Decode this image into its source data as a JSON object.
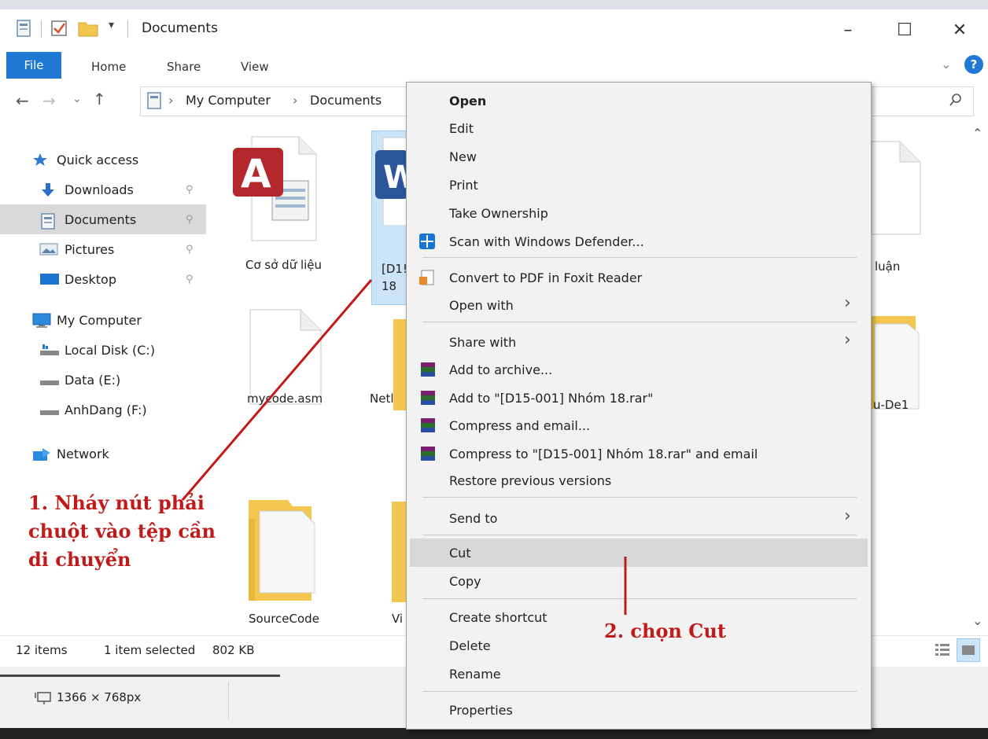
{
  "window": {
    "title": "Documents",
    "controls": {
      "minimize": "–",
      "maximize": "☐",
      "close": "✕"
    }
  },
  "ribbon": {
    "tabs": [
      "File",
      "Home",
      "Share",
      "View"
    ],
    "help": "?",
    "collapse": "⌄"
  },
  "address": {
    "back": "←",
    "forward": "→",
    "recent": "⌄",
    "up": "↑",
    "crumbs": [
      "My Computer",
      "Documents"
    ],
    "separator": "›",
    "search_icon": "search-icon"
  },
  "nav": {
    "items": [
      {
        "label": "Quick access",
        "icon": "star-icon",
        "pinned": false
      },
      {
        "label": "Downloads",
        "icon": "download-icon",
        "pinned": true
      },
      {
        "label": "Documents",
        "icon": "document-icon",
        "pinned": true,
        "selected": true
      },
      {
        "label": "Pictures",
        "icon": "pictures-icon",
        "pinned": true
      },
      {
        "label": "Desktop",
        "icon": "desktop-icon",
        "pinned": true
      },
      {
        "label": "My Computer",
        "icon": "computer-icon",
        "pinned": false
      },
      {
        "label": "Local Disk (C:)",
        "icon": "drive-icon",
        "pinned": false
      },
      {
        "label": "Data (E:)",
        "icon": "drive-icon",
        "pinned": false
      },
      {
        "label": "AnhDang (F:)",
        "icon": "drive-icon",
        "pinned": false
      },
      {
        "label": "Network",
        "icon": "network-icon",
        "pinned": false
      }
    ],
    "pin_glyph": "⚲"
  },
  "files": [
    {
      "name": "Cơ sở dữ liệu",
      "icon": "access-file-icon"
    },
    {
      "name_line1": "[D1!",
      "name_line2": "18",
      "icon": "word-file-icon",
      "selected": true
    },
    {
      "name": "luận",
      "icon": "text-file-icon"
    },
    {
      "name": "mycode.asm",
      "icon": "blank-file-icon"
    },
    {
      "name": "Netl",
      "icon": "folder-icon"
    },
    {
      "name": "u-De1",
      "icon": "folder-icon"
    },
    {
      "name": "SourceCode",
      "icon": "folder-icon"
    },
    {
      "name": "Vi",
      "icon": "folder-icon"
    }
  ],
  "status": {
    "items": "12 items",
    "selected": "1 item selected",
    "size": "802 KB"
  },
  "bottombar": {
    "dimensions": "1366 × 768px"
  },
  "context_menu": {
    "items": [
      {
        "label": "Open",
        "bold": true
      },
      {
        "label": "Edit"
      },
      {
        "label": "New"
      },
      {
        "label": "Print"
      },
      {
        "label": "Take Ownership"
      },
      {
        "label": "Scan with Windows Defender...",
        "icon": "defender-icon"
      },
      {
        "label": "Convert to PDF in Foxit Reader",
        "icon": "foxit-icon"
      },
      {
        "label": "Open with",
        "submenu": true
      },
      {
        "label": "Share with",
        "submenu": true
      },
      {
        "label": "Add to archive...",
        "icon": "winrar-icon"
      },
      {
        "label": "Add to \"[D15-001] Nhóm 18.rar\"",
        "icon": "winrar-icon"
      },
      {
        "label": "Compress and email...",
        "icon": "winrar-icon"
      },
      {
        "label": "Compress to \"[D15-001] Nhóm 18.rar\" and email",
        "icon": "winrar-icon"
      },
      {
        "label": "Restore previous versions"
      },
      {
        "label": "Send to",
        "submenu": true
      },
      {
        "label": "Cut",
        "highlighted": true
      },
      {
        "label": "Copy"
      },
      {
        "label": "Create shortcut"
      },
      {
        "label": "Delete"
      },
      {
        "label": "Rename"
      },
      {
        "label": "Properties"
      }
    ],
    "submenu_arrow": "›"
  },
  "annotations": {
    "step1_line1": "1. Nháy nút phải",
    "step1_line2": "chuột vào tệp cần",
    "step1_line3": "di chuyển",
    "step2": "2. chọn Cut",
    "color": "#c01a1a"
  }
}
